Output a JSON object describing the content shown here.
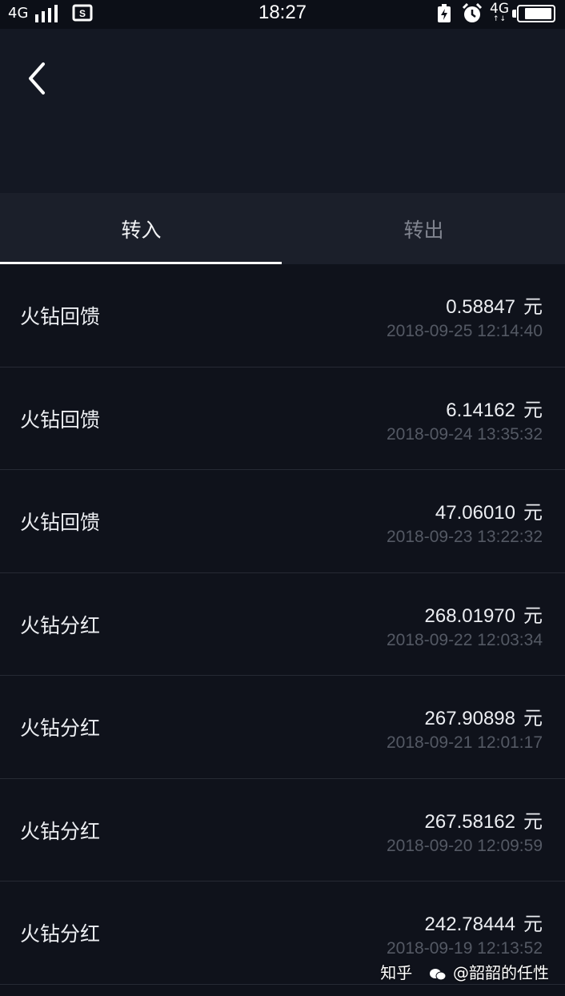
{
  "status_bar": {
    "network": "4G",
    "time": "18:27",
    "network2": "4G",
    "network2_sub": "↑↓",
    "icons": [
      "signal-icon",
      "sim-icon",
      "charging-icon",
      "alarm-icon",
      "battery-icon"
    ]
  },
  "header": {
    "back_icon": "chevron-left-icon"
  },
  "tabs": [
    {
      "label": "转入",
      "active": true
    },
    {
      "label": "转出",
      "active": false
    }
  ],
  "records": [
    {
      "title": "火钻回馈",
      "amount": "0.58847",
      "unit": "元",
      "time": "2018-09-25 12:14:40"
    },
    {
      "title": "火钻回馈",
      "amount": "6.14162",
      "unit": "元",
      "time": "2018-09-24 13:35:32"
    },
    {
      "title": "火钻回馈",
      "amount": "47.06010",
      "unit": "元",
      "time": "2018-09-23 13:22:32"
    },
    {
      "title": "火钻分红",
      "amount": "268.01970",
      "unit": "元",
      "time": "2018-09-22 12:03:34"
    },
    {
      "title": "火钻分红",
      "amount": "267.90898",
      "unit": "元",
      "time": "2018-09-21 12:01:17"
    },
    {
      "title": "火钻分红",
      "amount": "267.58162",
      "unit": "元",
      "time": "2018-09-20 12:09:59"
    },
    {
      "title": "火钻分红",
      "amount": "242.78444",
      "unit": "元",
      "time": "2018-09-19 12:13:52"
    }
  ],
  "watermark": {
    "site": "知乎",
    "author": "@韶韶的任性"
  },
  "colors": {
    "background": "#0f121b",
    "header": "#141823",
    "tabs": "#1b1f2a",
    "muted": "#545964"
  }
}
